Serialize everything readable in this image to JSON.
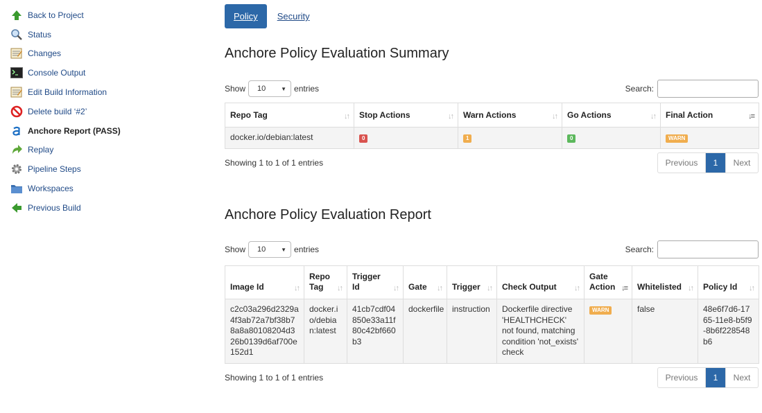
{
  "sidebar": {
    "items": [
      {
        "label": "Back to Project",
        "icon": "green-up-arrow-icon"
      },
      {
        "label": "Status",
        "icon": "magnifier-icon"
      },
      {
        "label": "Changes",
        "icon": "notepad-icon"
      },
      {
        "label": "Console Output",
        "icon": "terminal-icon"
      },
      {
        "label": "Edit Build Information",
        "icon": "notepad-icon"
      },
      {
        "label": "Delete build ‘#2’",
        "icon": "no-entry-icon"
      },
      {
        "label": "Anchore Report (PASS)",
        "icon": "anchore-logo-icon"
      },
      {
        "label": "Replay",
        "icon": "replay-arrow-icon"
      },
      {
        "label": "Pipeline Steps",
        "icon": "gear-icon"
      },
      {
        "label": "Workspaces",
        "icon": "folder-icon"
      },
      {
        "label": "Previous Build",
        "icon": "green-left-arrow-icon"
      }
    ]
  },
  "tabs": {
    "policy": "Policy",
    "security": "Security"
  },
  "summary": {
    "title": "Anchore Policy Evaluation Summary",
    "show_label": "Show",
    "entries_label": "entries",
    "page_size": "10",
    "search_label": "Search:",
    "columns": [
      "Repo Tag",
      "Stop Actions",
      "Warn Actions",
      "Go Actions",
      "Final Action"
    ],
    "row": {
      "repo_tag": "docker.io/debian:latest",
      "stop": "0",
      "warn": "1",
      "go": "0",
      "final": "WARN"
    },
    "info": "Showing 1 to 1 of 1 entries",
    "pager": {
      "previous": "Previous",
      "page": "1",
      "next": "Next"
    }
  },
  "report": {
    "title": "Anchore Policy Evaluation Report",
    "show_label": "Show",
    "entries_label": "entries",
    "page_size": "10",
    "search_label": "Search:",
    "columns": [
      "Image Id",
      "Repo Tag",
      "Trigger Id",
      "Gate",
      "Trigger",
      "Check Output",
      "Gate Action",
      "Whitelisted",
      "Policy Id"
    ],
    "row": {
      "image_id": "c2c03a296d2329a4f3ab72a7bf38b78a8a80108204d326b0139d6af700e152d1",
      "repo_tag": "docker.io/debian:latest",
      "trigger_id": "41cb7cdf04850e33a11f80c42bf660b3",
      "gate": "dockerfile",
      "trigger": "instruction",
      "check_output": "Dockerfile directive 'HEALTHCHECK' not found, matching condition 'not_exists' check",
      "gate_action": "WARN",
      "whitelisted": "false",
      "policy_id": "48e6f7d6-1765-11e8-b5f9-8b6f228548b6"
    },
    "info": "Showing 1 to 1 of 1 entries",
    "pager": {
      "previous": "Previous",
      "page": "1",
      "next": "Next"
    }
  },
  "colors": {
    "accent": "#2c68a8",
    "stop": "#d9534f",
    "warn": "#f0ad4e",
    "go": "#5cb85c",
    "link": "#204a87"
  }
}
